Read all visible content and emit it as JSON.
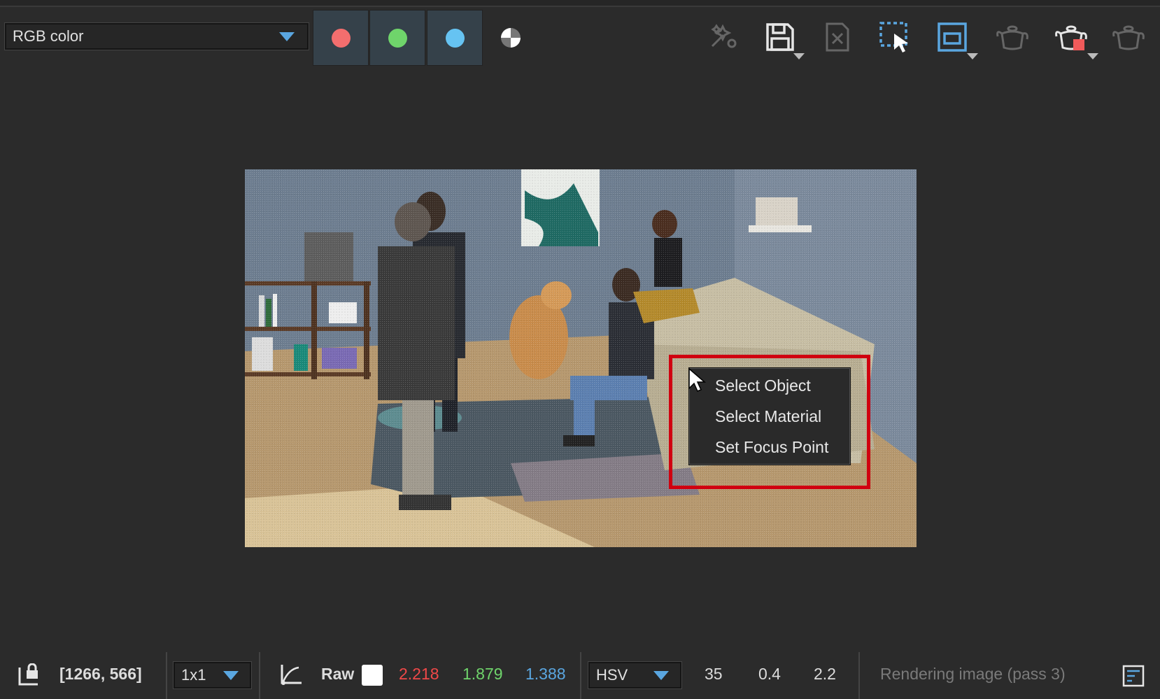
{
  "toolbar": {
    "channel_mode": "RGB color",
    "channels": [
      {
        "name": "red-channel",
        "color": "#f36e6e"
      },
      {
        "name": "green-channel",
        "color": "#6fd46b"
      },
      {
        "name": "blue-channel",
        "color": "#66c3f2"
      }
    ],
    "icons": [
      "alpha-channel-icon",
      "denoise-icon",
      "save-image-icon",
      "clear-image-icon",
      "select-region-icon",
      "frame-buffer-icon",
      "render-last-icon",
      "stop-render-icon",
      "render-icon"
    ]
  },
  "context_menu": {
    "items": [
      "Select Object",
      "Select Material",
      "Set Focus Point"
    ],
    "highlight_color": "#d00010"
  },
  "status_bar": {
    "coordinates": "[1266, 566]",
    "sample_size": "1x1",
    "color_space_label": "Raw",
    "rgb_values": {
      "r": "2.218",
      "g": "1.879",
      "b": "1.388"
    },
    "rgb_colors": {
      "r": "#f04848",
      "g": "#6fd46b",
      "b": "#5aa6e0"
    },
    "color_model": "HSV",
    "hsv_values": {
      "h": "35",
      "s": "0.4",
      "v": "2.2"
    },
    "status_message": "Rendering image (pass 3)"
  }
}
